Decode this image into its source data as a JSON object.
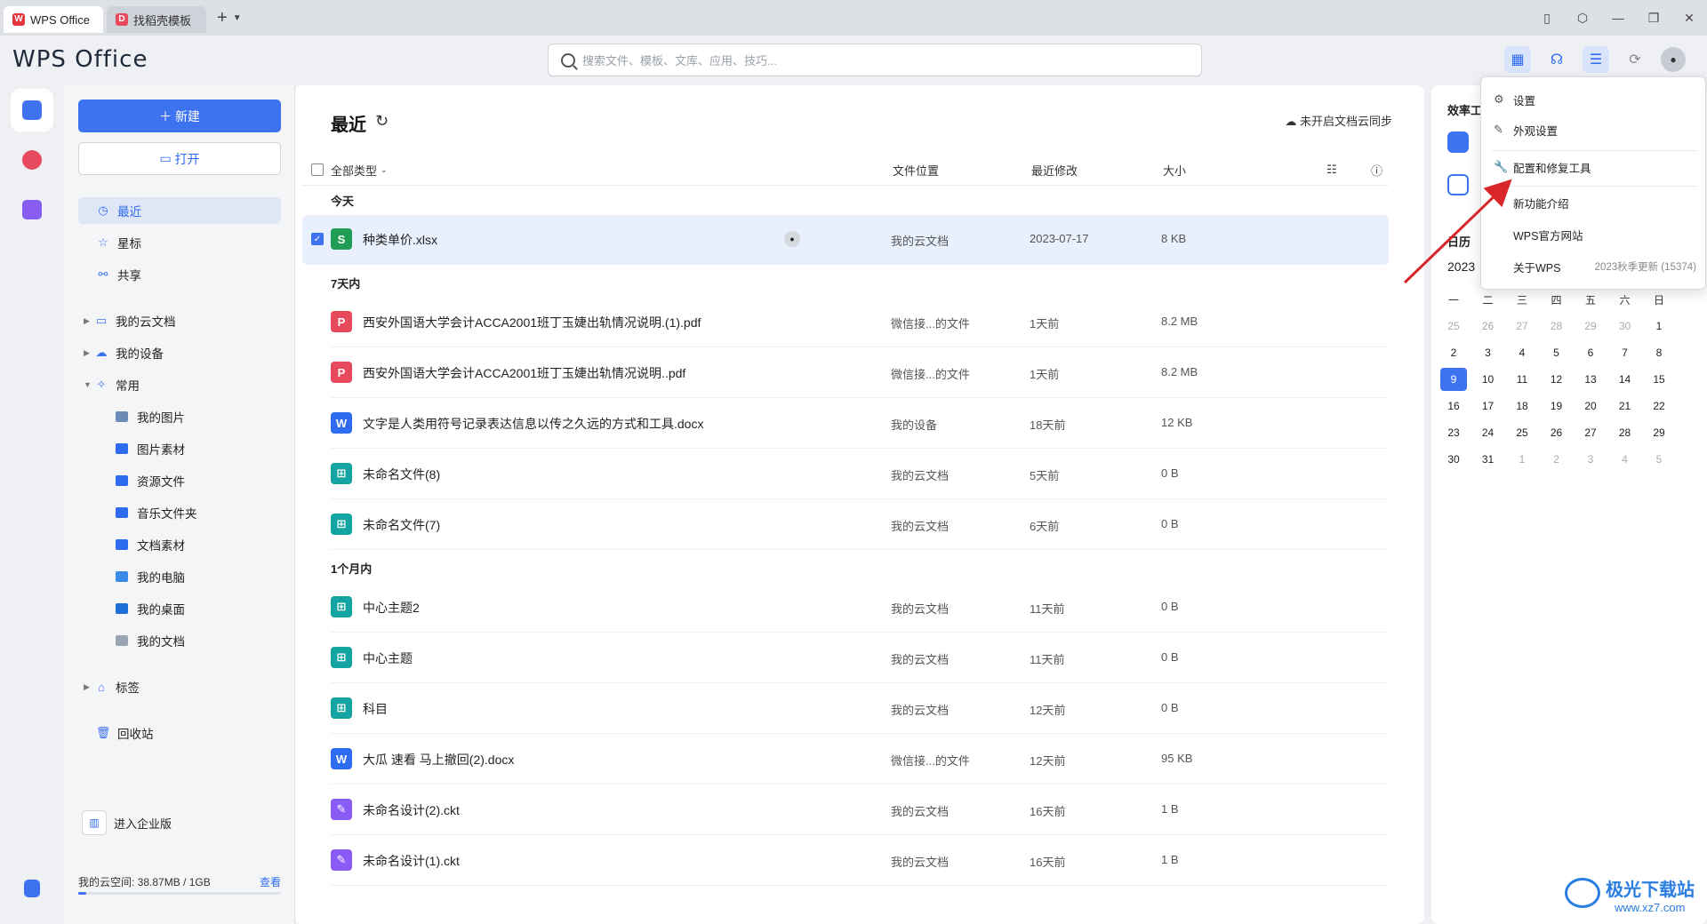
{
  "tabs": [
    {
      "label": "WPS Office",
      "icon": "wps-logo-icon"
    },
    {
      "label": "找稻壳模板",
      "icon": "docer-icon"
    }
  ],
  "tab_add": "+",
  "header": {
    "logo": "WPS Office",
    "search_placeholder": "搜索文件、模板、文库、应用、技巧..."
  },
  "sidebar": {
    "new_label": "新建",
    "open_label": "打开",
    "nav": [
      {
        "label": "最近",
        "icon": "clock-icon",
        "selected": true
      },
      {
        "label": "星标",
        "icon": "star-icon"
      },
      {
        "label": "共享",
        "icon": "share-icon"
      },
      {
        "label": "我的云文档",
        "icon": "folder-outline-icon",
        "expandable": true
      },
      {
        "label": "我的设备",
        "icon": "cloud-device-icon",
        "expandable": true
      },
      {
        "label": "常用",
        "icon": "pin-icon",
        "expanded": true
      },
      {
        "label": "我的图片",
        "icon": "image-folder-icon",
        "child": true
      },
      {
        "label": "图片素材",
        "icon": "folder-icon",
        "child": true
      },
      {
        "label": "资源文件",
        "icon": "folder-icon",
        "child": true
      },
      {
        "label": "音乐文件夹",
        "icon": "folder-icon",
        "child": true
      },
      {
        "label": "文档素材",
        "icon": "folder-icon",
        "child": true
      },
      {
        "label": "我的电脑",
        "icon": "computer-icon",
        "child": true
      },
      {
        "label": "我的桌面",
        "icon": "desktop-icon",
        "child": true
      },
      {
        "label": "我的文档",
        "icon": "document-icon",
        "child": true
      },
      {
        "label": "标签",
        "icon": "tag-icon",
        "expandable": true
      },
      {
        "label": "回收站",
        "icon": "trash-icon"
      }
    ],
    "enterprise": "进入企业版",
    "quota_label": "我的云空间: 38.87MB / 1GB",
    "quota_link": "查看",
    "quota_fraction": 0.04
  },
  "main": {
    "title": "最近",
    "cloud_sync": "未开启文档云同步",
    "columns": {
      "type": "全部类型",
      "location": "文件位置",
      "modified": "最近修改",
      "size": "大小"
    },
    "sections": [
      {
        "label": "今天",
        "files": [
          {
            "name": "种类单价.xlsx",
            "type": "xlsx",
            "letter": "S",
            "location": "我的云文档",
            "date": "2023-07-17",
            "size": "8 KB",
            "selected": true
          }
        ]
      },
      {
        "label": "7天内",
        "files": [
          {
            "name": "西安外国语大学会计ACCA2001班丁玉婕出轨情况说明.(1).pdf",
            "type": "pdf",
            "letter": "P",
            "location": "微信接...的文件",
            "date": "1天前",
            "size": "8.2 MB"
          },
          {
            "name": "西安外国语大学会计ACCA2001班丁玉婕出轨情况说明..pdf",
            "type": "pdf",
            "letter": "P",
            "location": "微信接...的文件",
            "date": "1天前",
            "size": "8.2 MB"
          },
          {
            "name": "文字是人类用符号记录表达信息以传之久远的方式和工具.docx",
            "type": "docx",
            "letter": "W",
            "location": "我的设备",
            "date": "18天前",
            "size": "12 KB"
          },
          {
            "name": "未命名文件(8)",
            "type": "mind",
            "letter": "⊞",
            "location": "我的云文档",
            "date": "5天前",
            "size": "0 B"
          },
          {
            "name": "未命名文件(7)",
            "type": "mind",
            "letter": "⊞",
            "location": "我的云文档",
            "date": "6天前",
            "size": "0 B"
          }
        ]
      },
      {
        "label": "1个月内",
        "files": [
          {
            "name": "中心主题2",
            "type": "mind",
            "letter": "⊞",
            "location": "我的云文档",
            "date": "11天前",
            "size": "0 B"
          },
          {
            "name": "中心主题",
            "type": "mind",
            "letter": "⊞",
            "location": "我的云文档",
            "date": "11天前",
            "size": "0 B"
          },
          {
            "name": "科目",
            "type": "mind",
            "letter": "⊞",
            "location": "我的云文档",
            "date": "12天前",
            "size": "0 B"
          },
          {
            "name": "大瓜 速看 马上撤回(2).docx",
            "type": "docx",
            "letter": "W",
            "location": "微信接...的文件",
            "date": "12天前",
            "size": "95 KB"
          },
          {
            "name": "未命名设计(2).ckt",
            "type": "ckt",
            "letter": "✎",
            "location": "我的云文档",
            "date": "16天前",
            "size": "1 B"
          },
          {
            "name": "未命名设计(1).ckt",
            "type": "ckt",
            "letter": "✎",
            "location": "我的云文档",
            "date": "16天前",
            "size": "1 B"
          }
        ]
      }
    ]
  },
  "rpanel": {
    "title": "效率工",
    "calendar_title": "日历",
    "calendar_ym": "2023",
    "weekdays": [
      "一",
      "二",
      "三",
      "四",
      "五",
      "六",
      "日"
    ],
    "weeks": [
      [
        "25",
        "26",
        "27",
        "28",
        "29",
        "30",
        "1"
      ],
      [
        "2",
        "3",
        "4",
        "5",
        "6",
        "7",
        "8"
      ],
      [
        "9",
        "10",
        "11",
        "12",
        "13",
        "14",
        "15"
      ],
      [
        "16",
        "17",
        "18",
        "19",
        "20",
        "21",
        "22"
      ],
      [
        "23",
        "24",
        "25",
        "26",
        "27",
        "28",
        "29"
      ],
      [
        "30",
        "31",
        "1",
        "2",
        "3",
        "4",
        "5"
      ]
    ],
    "today": "9"
  },
  "menu": {
    "items": [
      {
        "label": "设置",
        "icon": "gear-icon"
      },
      {
        "label": "外观设置",
        "icon": "brush-icon"
      },
      {
        "label": "配置和修复工具",
        "icon": "wrench-icon"
      },
      {
        "label": "新功能介绍"
      },
      {
        "label": "WPS官方网站"
      },
      {
        "label": "关于WPS",
        "version": "2023秋季更新 (15374)"
      }
    ]
  },
  "watermark": {
    "title": "极光下载站",
    "url": "www.xz7.com"
  },
  "colors": {
    "accent": "#3d72f0",
    "arrow": "#d9262a"
  }
}
